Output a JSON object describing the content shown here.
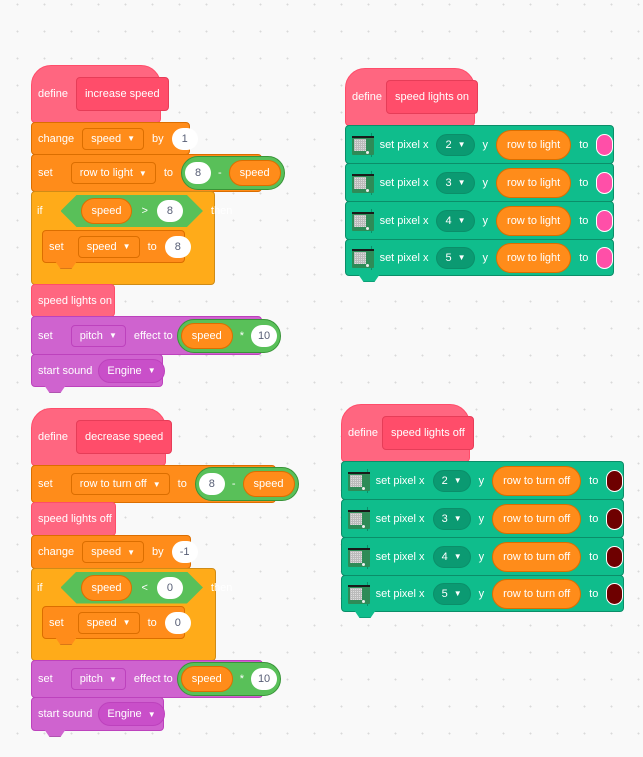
{
  "scripts": {
    "increase": {
      "define_label": "define",
      "proc_name": "increase speed",
      "change": {
        "label": "change",
        "var": "speed",
        "by_label": "by",
        "value": "1"
      },
      "set_row": {
        "label": "set",
        "var": "row to light",
        "to_label": "to",
        "left": "8",
        "op": "-",
        "right": "speed"
      },
      "if": {
        "label": "if",
        "left": "speed",
        "op": ">",
        "right": "8",
        "then_label": "then"
      },
      "inner_set": {
        "label": "set",
        "var": "speed",
        "to_label": "to",
        "value": "8"
      },
      "call": {
        "label": "speed lights on"
      },
      "set_effect": {
        "label": "set",
        "effect": "pitch",
        "to_label": "effect to",
        "left": "speed",
        "op": "*",
        "right": "10"
      },
      "sound": {
        "label": "start sound",
        "sound": "Engine"
      }
    },
    "decrease": {
      "define_label": "define",
      "proc_name": "decrease speed",
      "set_row": {
        "label": "set",
        "var": "row to turn off",
        "to_label": "to",
        "left": "8",
        "op": "-",
        "right": "speed"
      },
      "call": {
        "label": "speed lights off"
      },
      "change": {
        "label": "change",
        "var": "speed",
        "by_label": "by",
        "value": "-1"
      },
      "if": {
        "label": "if",
        "left": "speed",
        "op": "<",
        "right": "0",
        "then_label": "then"
      },
      "inner_set": {
        "label": "set",
        "var": "speed",
        "to_label": "to",
        "value": "0"
      },
      "set_effect": {
        "label": "set",
        "effect": "pitch",
        "to_label": "effect to",
        "left": "speed",
        "op": "*",
        "right": "10"
      },
      "sound": {
        "label": "start sound",
        "sound": "Engine"
      }
    },
    "lights_on": {
      "define_label": "define",
      "proc_name": "speed lights on",
      "pixel_label": "set pixel x",
      "y_label": "y",
      "to_label": "to",
      "color": "#ff4fa8",
      "rows": [
        {
          "x": "2",
          "y": "row to light"
        },
        {
          "x": "3",
          "y": "row to light"
        },
        {
          "x": "4",
          "y": "row to light"
        },
        {
          "x": "5",
          "y": "row to light"
        }
      ]
    },
    "lights_off": {
      "define_label": "define",
      "proc_name": "speed lights off",
      "pixel_label": "set pixel x",
      "y_label": "y",
      "to_label": "to",
      "color": "#6e0000",
      "rows": [
        {
          "x": "2",
          "y": "row to turn off"
        },
        {
          "x": "3",
          "y": "row to turn off"
        },
        {
          "x": "4",
          "y": "row to turn off"
        },
        {
          "x": "5",
          "y": "row to turn off"
        }
      ]
    }
  },
  "icons": {
    "caret": "▼"
  }
}
